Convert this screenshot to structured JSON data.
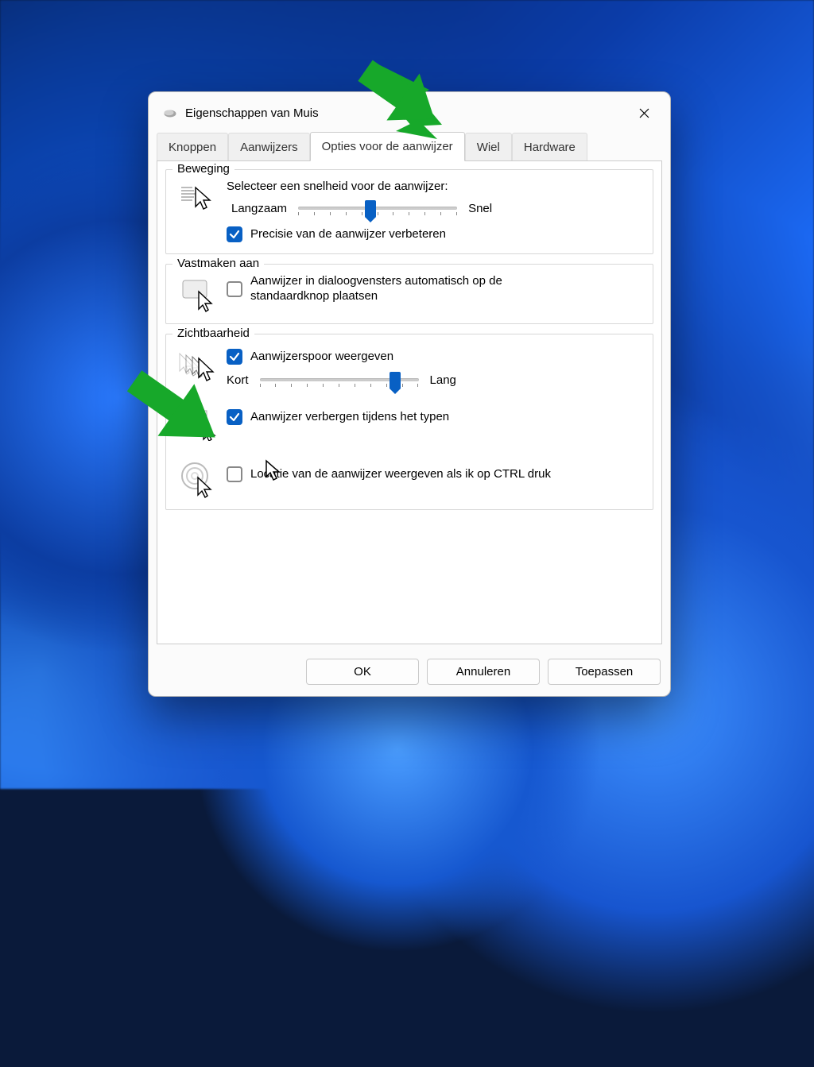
{
  "window": {
    "title": "Eigenschappen van Muis"
  },
  "tabs": [
    "Knoppen",
    "Aanwijzers",
    "Opties voor de aanwijzer",
    "Wiel",
    "Hardware"
  ],
  "active_tab_index": 2,
  "groups": {
    "motion": {
      "legend": "Beweging",
      "speed_label": "Selecteer een snelheid voor de aanwijzer:",
      "slow": "Langzaam",
      "fast": "Snel",
      "precision_label": "Precisie van de aanwijzer verbeteren",
      "precision_checked": true,
      "speed_value_pct": 45
    },
    "snap": {
      "legend": "Vastmaken aan",
      "snap_label": "Aanwijzer in dialoogvensters automatisch op de standaardknop plaatsen",
      "snap_checked": false
    },
    "visibility": {
      "legend": "Zichtbaarheid",
      "trail_label": "Aanwijzerspoor weergeven",
      "trail_checked": true,
      "trail_short": "Kort",
      "trail_long": "Lang",
      "trail_value_pct": 88,
      "hide_typing_label": "Aanwijzer verbergen tijdens het typen",
      "hide_typing_checked": true,
      "ctrl_locate_label": "Locatie van de aanwijzer weergeven als ik op CTRL druk",
      "ctrl_locate_checked": false
    }
  },
  "buttons": {
    "ok": "OK",
    "cancel": "Annuleren",
    "apply": "Toepassen"
  }
}
